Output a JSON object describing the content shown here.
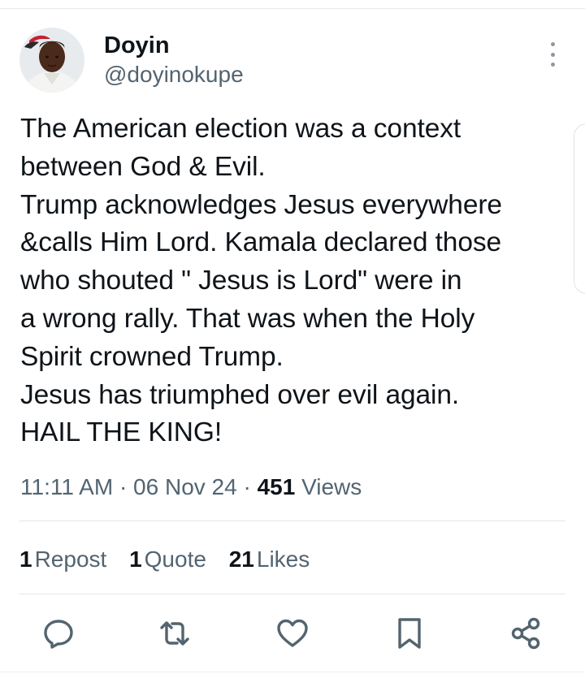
{
  "author": {
    "display_name": "Doyin",
    "handle": "@doyinokupe",
    "avatar_icon": "profile-photo"
  },
  "tweet": {
    "lines": [
      "The American election was a context",
      "between God & Evil.",
      "Trump acknowledges Jesus everywhere",
      "&calls Him Lord. Kamala declared those",
      "who shouted \" Jesus is Lord\" were in",
      "a wrong rally. That was when the Holy",
      "Spirit crowned Trump.",
      "Jesus has triumphed over evil again.",
      "HAIL THE KING!"
    ]
  },
  "meta": {
    "time": "11:11 AM",
    "separator": "·",
    "date": "06 Nov 24",
    "views_count": "451",
    "views_label": "Views"
  },
  "stats": {
    "reposts_count": "1",
    "reposts_label": "Repost",
    "quotes_count": "1",
    "quotes_label": "Quote",
    "likes_count": "21",
    "likes_label": "Likes"
  },
  "actions": [
    "reply-icon",
    "retweet-icon",
    "like-icon",
    "bookmark-icon",
    "share-icon"
  ],
  "colors": {
    "text": "#0f1419",
    "secondary": "#536471",
    "divider": "#e1e5e9",
    "action_icon": "#53646f"
  }
}
